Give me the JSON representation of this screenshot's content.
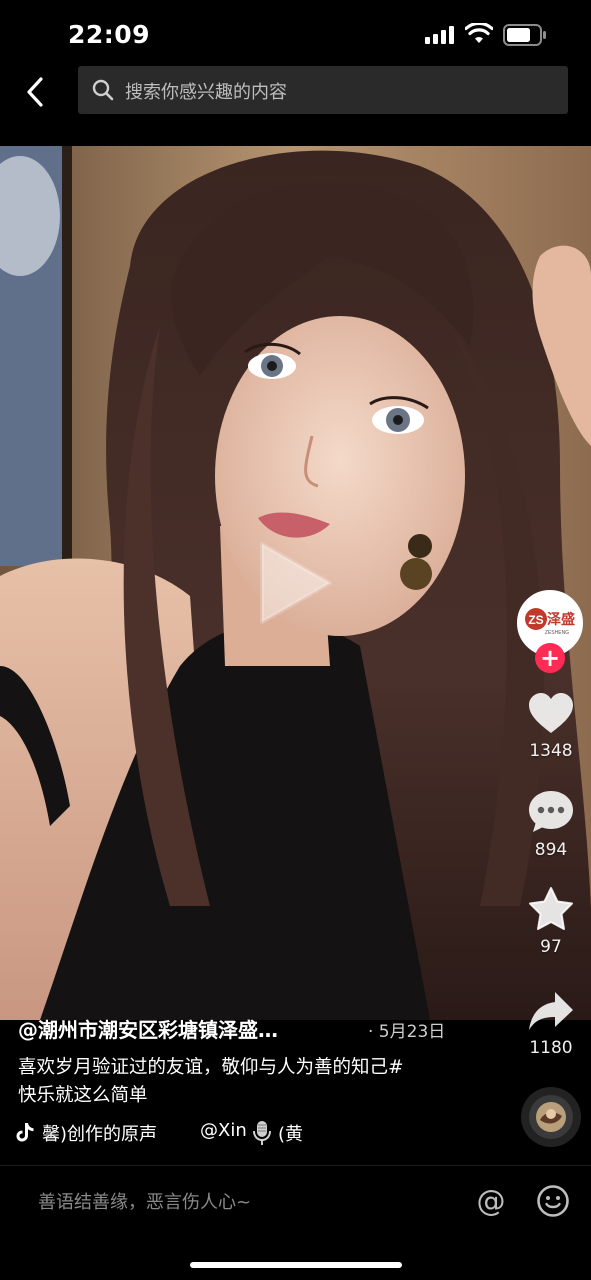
{
  "status_bar": {
    "time": "22:09"
  },
  "header": {
    "back_icon": "chevron-left-icon",
    "search_placeholder": "搜索你感兴趣的内容"
  },
  "video": {
    "state": "paused",
    "play_icon": "play-icon"
  },
  "sidebar": {
    "avatar_text": "泽盛",
    "avatar_logo": "ZS",
    "avatar_sub": "ZESHENG",
    "follow_symbol": "+",
    "likes": "1348",
    "comments": "894",
    "favorites": "97",
    "shares": "1180"
  },
  "post": {
    "author": "@潮州市潮安区彩塘镇泽盛…",
    "date": "· 5月23日",
    "caption_line1": "喜欢岁月验证过的友谊，敬仰与人为善的知己#",
    "caption_line2": "快乐就这么简单",
    "music_title": "馨)创作的原声",
    "music_mention": "@Xin",
    "music_tail": "(黄"
  },
  "comment_bar": {
    "placeholder": "善语结善缘，恶言伤人心~",
    "at_symbol": "@"
  },
  "colors": {
    "accent": "#fe2c55",
    "background": "#000000",
    "search_bg": "#2a2a2a"
  }
}
